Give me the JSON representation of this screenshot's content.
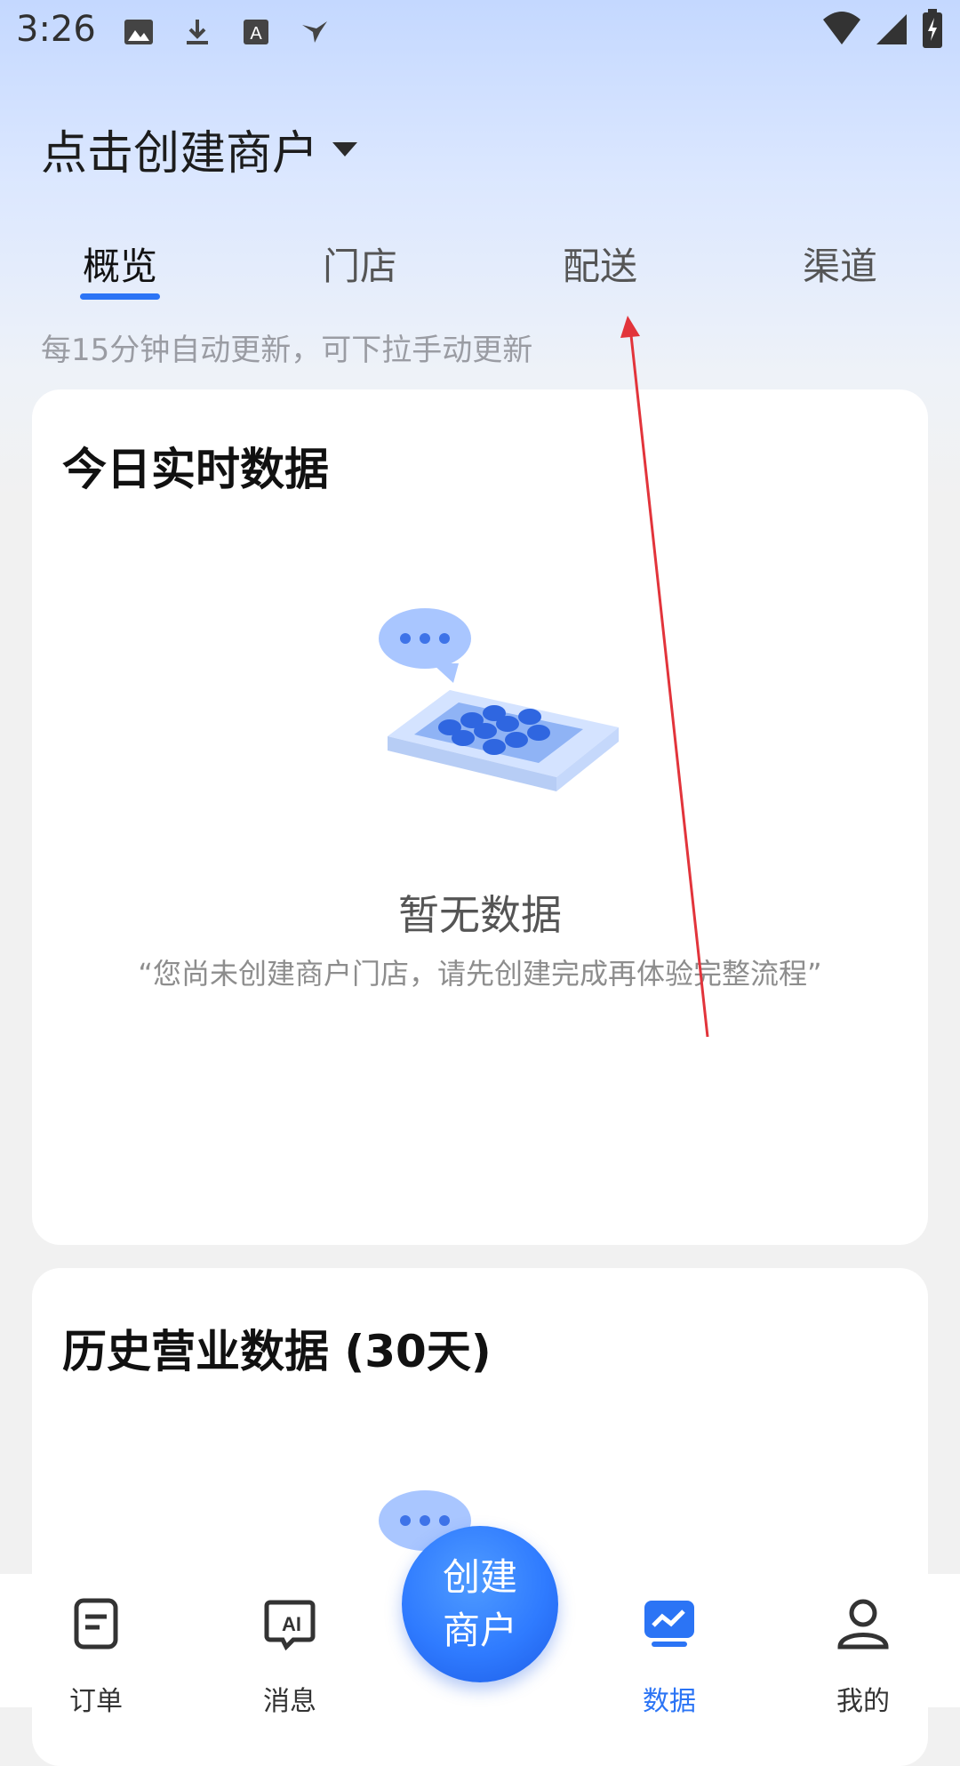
{
  "status_bar": {
    "time": "3:26",
    "icons": [
      "image-icon",
      "download-icon",
      "font-a-icon",
      "bird-icon"
    ],
    "right_icons": [
      "wifi-icon",
      "signal-icon",
      "battery-charging-icon"
    ]
  },
  "header": {
    "merchant_selector": "点击创建商户"
  },
  "tabs": [
    "概览",
    "门店",
    "配送",
    "渠道"
  ],
  "active_tab": "概览",
  "hint": "每15分钟自动更新，可下拉手动更新",
  "realtime_card": {
    "title": "今日实时数据",
    "empty_title": "暂无数据",
    "empty_desc": "“您尚未创建商户门店，请先创建完成再体验完整流程”"
  },
  "history_card": {
    "title": "历史营业数据 (30天)"
  },
  "bottom_nav": {
    "items": [
      {
        "label": "订单",
        "icon": "order-icon"
      },
      {
        "label": "消息",
        "icon": "ai-message-icon"
      },
      {
        "label": "数据",
        "icon": "data-chart-icon"
      },
      {
        "label": "我的",
        "icon": "profile-icon"
      }
    ],
    "fab_line1": "创建",
    "fab_line2": "商户"
  },
  "colors": {
    "accent": "#2b74f5",
    "annotation_arrow": "#e2343b"
  }
}
